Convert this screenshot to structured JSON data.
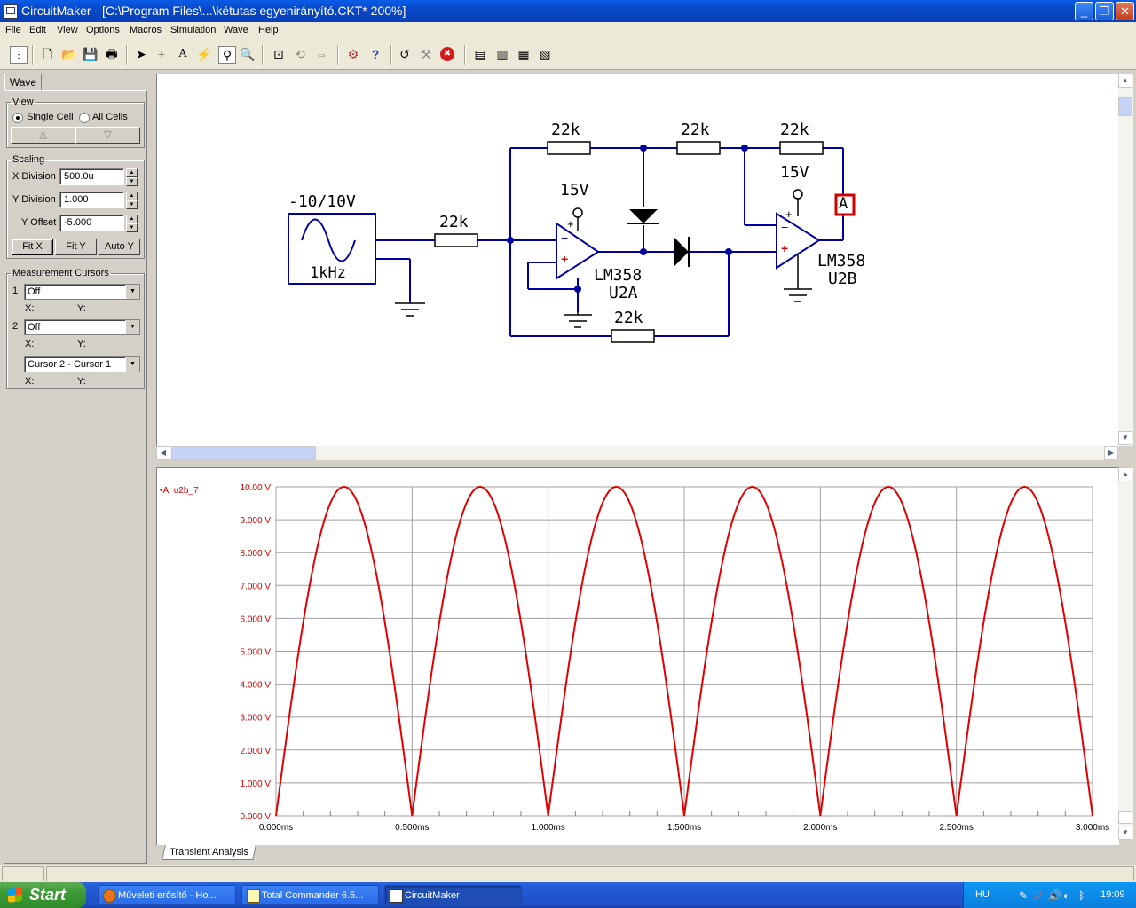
{
  "window": {
    "title": "CircuitMaker - [C:\\Program Files\\...\\kétutas egyenirányító.CKT* 200%]",
    "controls": {
      "minimize": "_",
      "restore": "❐",
      "close": "✕"
    }
  },
  "menu": [
    "File",
    "Edit",
    "View",
    "Options",
    "Macros",
    "Simulation",
    "Wave",
    "Help"
  ],
  "toolbar": {
    "buttons": [
      {
        "name": "sim-settings-icon",
        "glyph": "⫶"
      },
      {
        "name": "new-file-icon",
        "glyph": "🗋"
      },
      {
        "name": "open-folder-icon",
        "glyph": "📂"
      },
      {
        "name": "save-icon",
        "glyph": "💾"
      },
      {
        "name": "print-icon",
        "glyph": "🖶"
      },
      {
        "name": "arrow-pointer-icon",
        "glyph": "➤"
      },
      {
        "name": "wire-tool-icon",
        "glyph": "+"
      },
      {
        "name": "text-tool-icon",
        "glyph": "A"
      },
      {
        "name": "probe-icon",
        "glyph": "⚡"
      },
      {
        "name": "probe-tool-icon",
        "glyph": "⚲"
      },
      {
        "name": "zoom-icon",
        "glyph": "🔍"
      },
      {
        "name": "fit-page-icon",
        "glyph": "⊡"
      },
      {
        "name": "rotate-icon",
        "glyph": "⟲"
      },
      {
        "name": "mirror-icon",
        "glyph": "⇔"
      },
      {
        "name": "device-icon",
        "glyph": "⚙"
      },
      {
        "name": "help-icon",
        "glyph": "?"
      },
      {
        "name": "reset-icon",
        "glyph": "↺"
      },
      {
        "name": "step-icon",
        "glyph": "⚒"
      },
      {
        "name": "stop-icon",
        "glyph": "✖"
      },
      {
        "name": "analyses-icon",
        "glyph": "▤"
      },
      {
        "name": "wave-1-icon",
        "glyph": "▥"
      },
      {
        "name": "wave-2-icon",
        "glyph": "▦"
      },
      {
        "name": "wave-3-icon",
        "glyph": "▧"
      }
    ]
  },
  "left_panel": {
    "tab": "Wave",
    "view": {
      "legend": "View",
      "single_cell": "Single Cell",
      "all_cells": "All Cells",
      "up": "△",
      "down": "▽"
    },
    "scaling": {
      "legend": "Scaling",
      "x_division_label": "X Division",
      "x_division_value": "500.0u",
      "y_division_label": "Y Division",
      "y_division_value": "1.000",
      "y_offset_label": "Y Offset",
      "y_offset_value": "-5.000",
      "fit_x": "Fit X",
      "fit_y": "Fit Y",
      "auto_y": "Auto Y"
    },
    "cursors": {
      "legend": "Measurement Cursors",
      "c1_num": "1",
      "c1_value": "Off",
      "c2_num": "2",
      "c2_value": "Off",
      "diff_value": "Cursor 2 - Cursor 1",
      "x_label": "X:",
      "y_label": "Y:"
    }
  },
  "schematic": {
    "source_label": "-10/10V",
    "source_freq": "1kHz",
    "resistors": [
      "22k",
      "22k",
      "22k",
      "22k",
      "22k"
    ],
    "vcc1": "15V",
    "vcc2": "15V",
    "opamp1_model": "LM358",
    "opamp1_ref": "U2A",
    "opamp2_model": "LM358",
    "opamp2_ref": "U2B",
    "probe_label": "A",
    "minus": "−",
    "plus": "+"
  },
  "wave_tab": "Transient Analysis",
  "chart_data": {
    "type": "line",
    "legend_label": "•A: u2b_7",
    "series": [
      {
        "name": "A: u2b_7",
        "color": "#e00000",
        "description_formula": "10*|sin(2π·1000·t)|"
      }
    ],
    "x_ticks": [
      "0.000ms",
      "0.500ms",
      "1.000ms",
      "1.500ms",
      "2.000ms",
      "2.500ms",
      "3.000ms"
    ],
    "y_ticks": [
      "0.000 V",
      "1.000 V",
      "2.000 V",
      "3.000 V",
      "4.000 V",
      "5.000 V",
      "6.000 V",
      "7.000 V",
      "8.000 V",
      "9.000 V",
      "10.00 V"
    ],
    "xlim_ms": [
      0,
      3
    ],
    "ylim": [
      0,
      10
    ],
    "amplitude": 10,
    "frequency_hz": 1000,
    "grid": true,
    "peaks": [
      {
        "x_ms": 0.25,
        "y": 10
      },
      {
        "x_ms": 0.75,
        "y": 10
      },
      {
        "x_ms": 1.25,
        "y": 10
      },
      {
        "x_ms": 1.75,
        "y": 10
      },
      {
        "x_ms": 2.25,
        "y": 10
      },
      {
        "x_ms": 2.75,
        "y": 10
      }
    ],
    "zeros": [
      {
        "x_ms": 0.0,
        "y": 0
      },
      {
        "x_ms": 0.5,
        "y": 0
      },
      {
        "x_ms": 1.0,
        "y": 0
      },
      {
        "x_ms": 1.5,
        "y": 0
      },
      {
        "x_ms": 2.0,
        "y": 0
      },
      {
        "x_ms": 2.5,
        "y": 0
      },
      {
        "x_ms": 3.0,
        "y": 0
      }
    ]
  },
  "taskbar": {
    "start": "Start",
    "tasks": [
      "Műveleti erősítő - Ho...",
      "Total Commander 6.5...",
      "CircuitMaker"
    ],
    "lang": "HU",
    "clock": "19:09"
  }
}
